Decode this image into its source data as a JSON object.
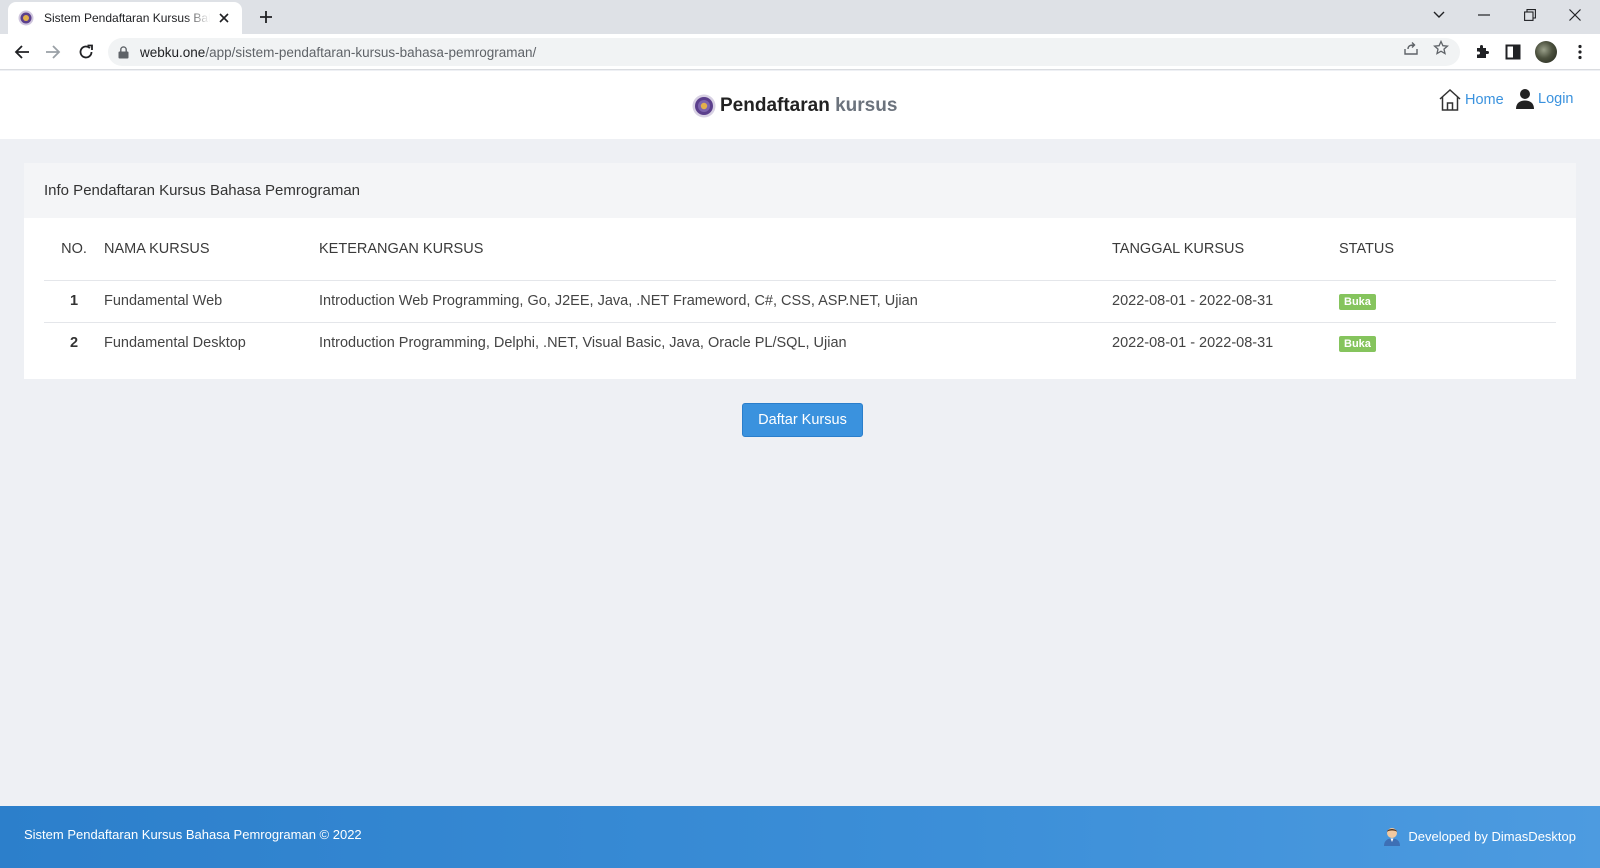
{
  "browser": {
    "tab_title": "Sistem Pendaftaran Kursus Bahasa Pemrograman",
    "url_host": "webku.one",
    "url_path": "/app/sistem-pendaftaran-kursus-bahasa-pemrograman/"
  },
  "header": {
    "brand_main": "Pendaftaran",
    "brand_accent": "kursus",
    "nav": {
      "home": "Home",
      "login": "Login"
    }
  },
  "card": {
    "title": "Info Pendaftaran Kursus Bahasa Pemrograman",
    "columns": [
      "NO.",
      "NAMA KURSUS",
      "KETERANGAN KURSUS",
      "TANGGAL KURSUS",
      "STATUS"
    ],
    "rows": [
      {
        "no": "1",
        "name": "Fundamental Web",
        "description": "Introduction Web Programming, Go, J2EE, Java, .NET Frameword, C#, CSS, ASP.NET, Ujian",
        "date": "2022-08-01 - 2022-08-31",
        "status": "Buka"
      },
      {
        "no": "2",
        "name": "Fundamental Desktop",
        "description": "Introduction Programming, Delphi, .NET, Visual Basic, Java, Oracle PL/SQL, Ujian",
        "date": "2022-08-01 - 2022-08-31",
        "status": "Buka"
      }
    ]
  },
  "actions": {
    "daftar_label": "Daftar Kursus"
  },
  "footer": {
    "left": "Sistem Pendaftaran Kursus Bahasa Pemrograman © 2022",
    "right": "Developed by DimasDesktop"
  },
  "colors": {
    "primary": "#3a92de",
    "badge": "#85c45d",
    "page_bg": "#eef0f4"
  },
  "icons": [
    "site-favicon",
    "close-icon",
    "plus-icon",
    "chevron-down-icon",
    "minimize-icon",
    "restore-icon",
    "window-close-icon",
    "back-arrow-icon",
    "forward-arrow-icon",
    "reload-icon",
    "lock-icon",
    "share-icon",
    "star-icon",
    "puzzle-icon",
    "side-panel-icon",
    "kebab-menu-icon",
    "home-icon",
    "user-icon",
    "developer-avatar-icon"
  ]
}
